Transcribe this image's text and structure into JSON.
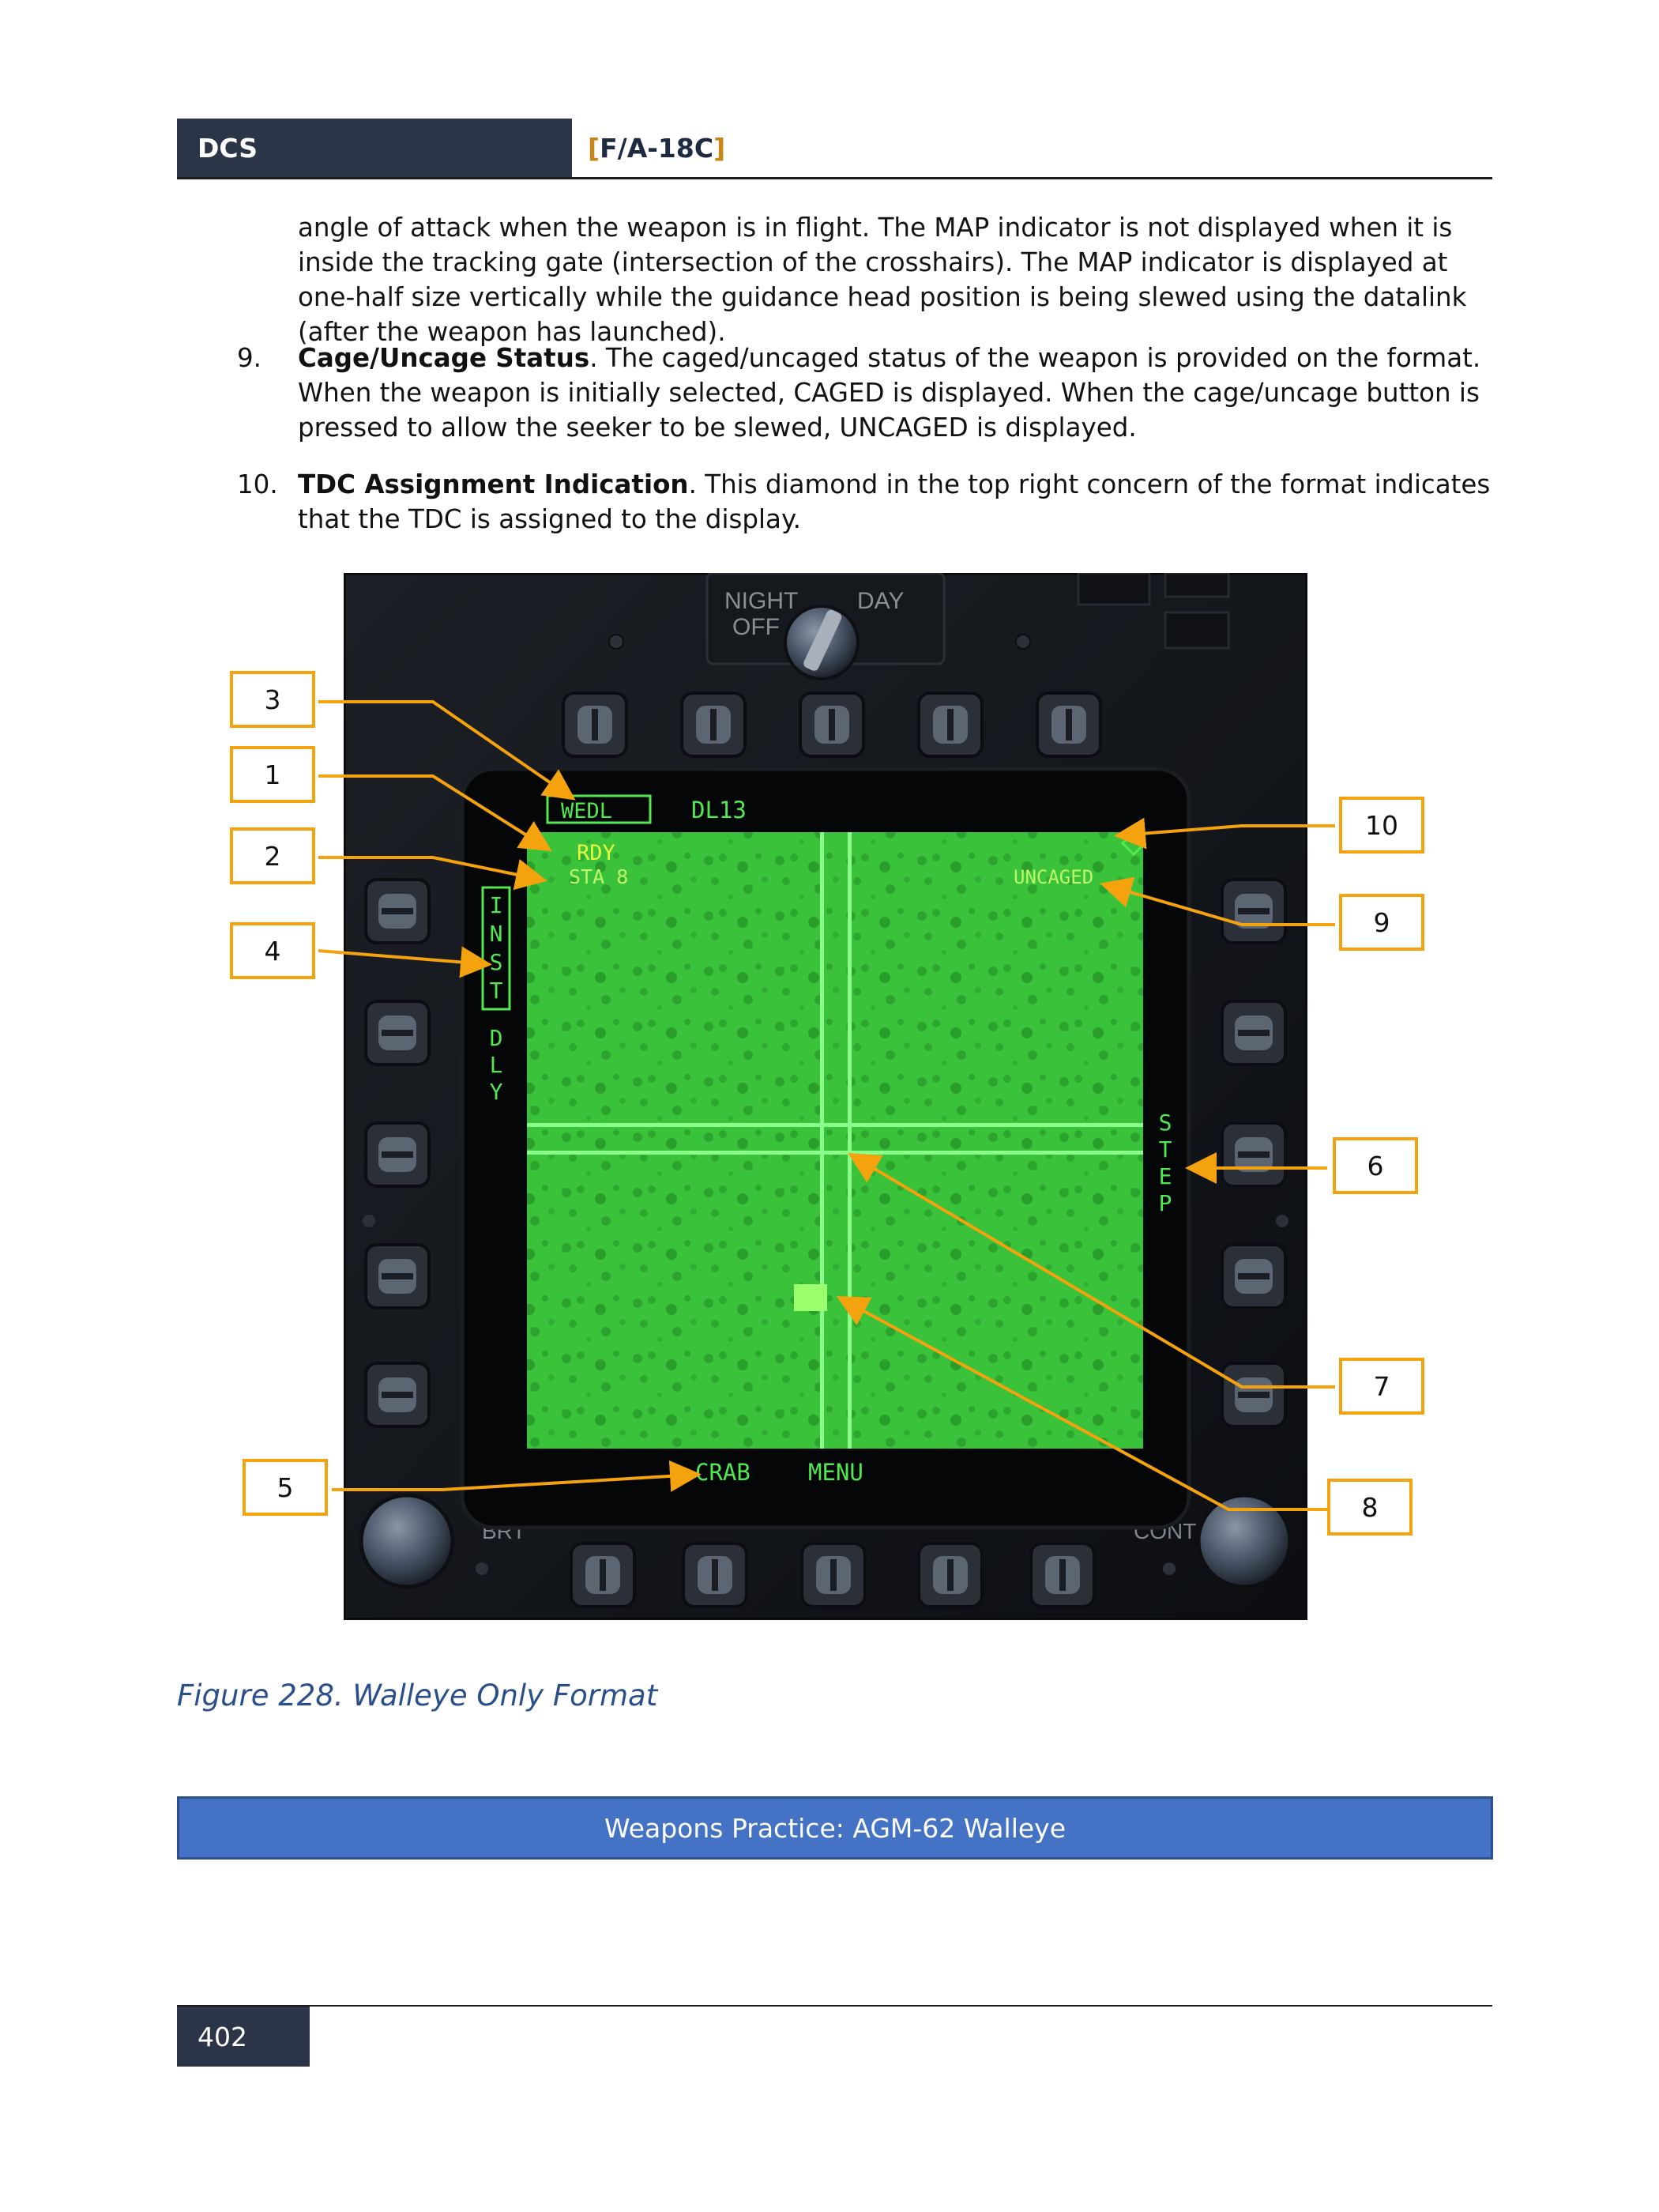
{
  "header": {
    "left": "DCS",
    "right_open": "[",
    "right_title": "F/A-18C",
    "right_close": "]"
  },
  "intro_text": "angle of attack when the weapon is in flight. The MAP indicator is not displayed when it is inside the tracking gate (intersection of the crosshairs). The MAP indicator is displayed at one-half size vertically while the guidance head position is being slewed using the datalink (after the weapon has launched).",
  "items": [
    {
      "num": "9.",
      "title": "Cage/Uncage Status",
      "text": ". The caged/uncaged status of the weapon is provided on the format. When the weapon is initially selected, CAGED is displayed. When the cage/uncage button is pressed to allow the seeker to be slewed, UNCAGED is displayed."
    },
    {
      "num": "10.",
      "title": "TDC Assignment Indication",
      "text": ". This diamond in the top right concern of the format indicates that the TDC is assigned to the display."
    }
  ],
  "mfd": {
    "knob_left": "NIGHT",
    "knob_right": "DAY",
    "knob_off": "OFF",
    "wedl": "WEDL",
    "dl": "DL13",
    "rdy": "RDY",
    "sta": "STA 8",
    "uncaged": "UNCAGED",
    "inst": "INST",
    "dly": "DLY",
    "step": "STEP",
    "crab": "CRAB",
    "menu": "MENU",
    "brt": "BRT",
    "cont": "CONT"
  },
  "callouts": [
    "3",
    "1",
    "2",
    "4",
    "5",
    "10",
    "9",
    "6",
    "7",
    "8"
  ],
  "colors": {
    "accent": "#f4a20e",
    "screen": "#2bd42b",
    "header": "#2b3547",
    "banner": "#4472c4"
  },
  "caption": "Figure 228. Walleye Only Format",
  "banner": "Weapons Practice: AGM-62 Walleye",
  "page_number": "402"
}
